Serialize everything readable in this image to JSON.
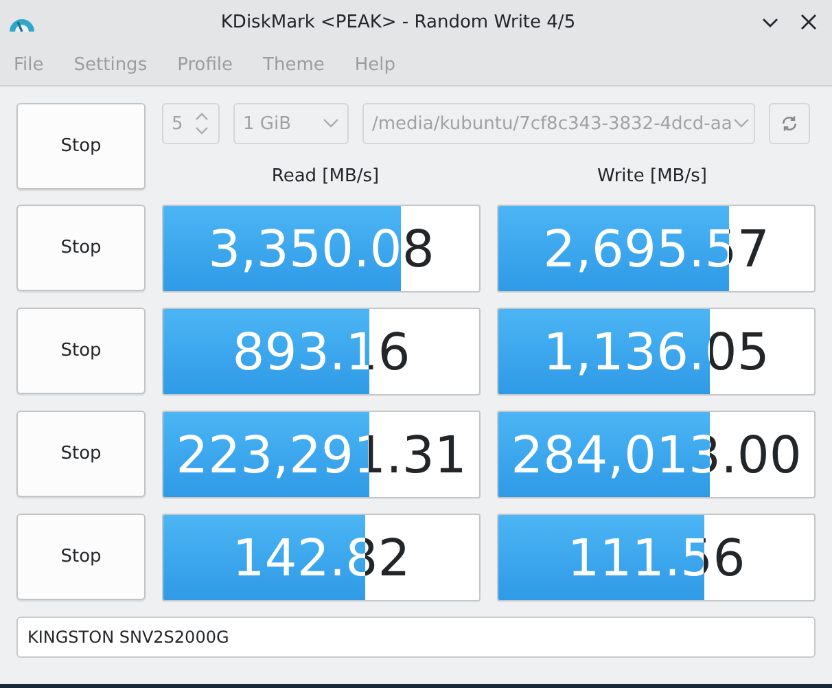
{
  "window": {
    "title": "KDiskMark <PEAK> - Random Write 4/5"
  },
  "menu": [
    "File",
    "Settings",
    "Profile",
    "Theme",
    "Help"
  ],
  "menu_disabled": true,
  "main_button": "Stop",
  "runs": {
    "value": "5",
    "disabled": true
  },
  "size": {
    "value": "1 GiB",
    "disabled": true
  },
  "path": {
    "value": "/media/kubuntu/7cf8c343-3832-4dcd-aa",
    "disabled": true
  },
  "columns": [
    "Read [MB/s]",
    "Write [MB/s]"
  ],
  "rows": [
    {
      "button": "Stop",
      "read": {
        "text": "3,350.08",
        "level": 0.75
      },
      "write": {
        "text": "2,695.57",
        "level": 0.73
      }
    },
    {
      "button": "Stop",
      "read": {
        "text": "893.16",
        "level": 0.65
      },
      "write": {
        "text": "1,136.05",
        "level": 0.67
      }
    },
    {
      "button": "Stop",
      "read": {
        "text": "223,291.31",
        "level": 0.65
      },
      "write": {
        "text": "284,013.00",
        "level": 0.67
      }
    },
    {
      "button": "Stop",
      "read": {
        "text": "142.82",
        "level": 0.64
      },
      "write": {
        "text": "111.56",
        "level": 0.65
      }
    }
  ],
  "device": "KINGSTON SNV2S2000G"
}
